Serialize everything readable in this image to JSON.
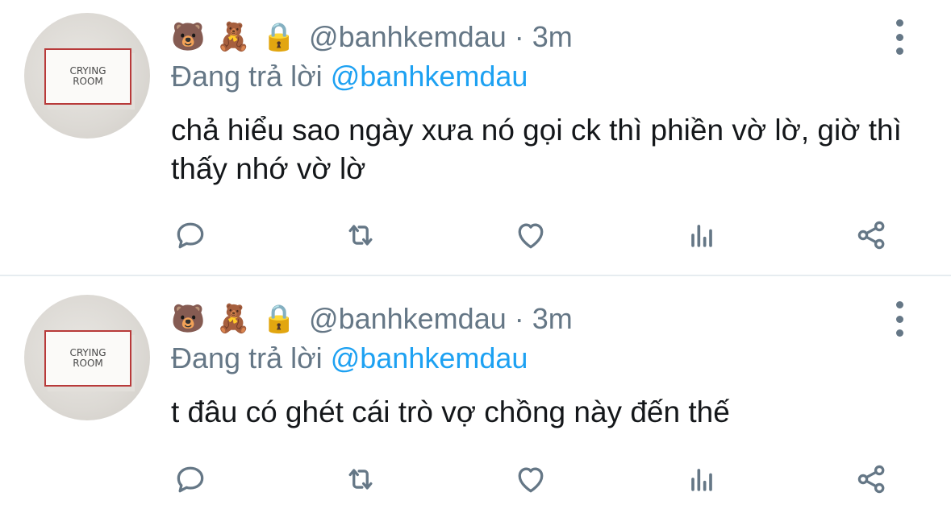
{
  "tweets": [
    {
      "avatar_text_line1": "CRYING",
      "avatar_text_line2": "ROOM",
      "name_emojis": [
        "🐻",
        "🧸",
        "🔒"
      ],
      "handle": "@banhkemdau",
      "separator": "·",
      "time": "3m",
      "reply_prefix": "Đang trả lời",
      "reply_to": "@banhkemdau",
      "text": "chả hiểu sao ngày xưa nó gọi ck thì phiền vờ lờ, giờ thì thấy nhớ vờ lờ"
    },
    {
      "avatar_text_line1": "CRYING",
      "avatar_text_line2": "ROOM",
      "name_emojis": [
        "🐻",
        "🧸",
        "🔒"
      ],
      "handle": "@banhkemdau",
      "separator": "·",
      "time": "3m",
      "reply_prefix": "Đang trả lời",
      "reply_to": "@banhkemdau",
      "text": "t đâu có ghét cái trò vợ chồng này đến thế"
    }
  ],
  "icons": {
    "reply": "reply-icon",
    "retweet": "retweet-icon",
    "like": "heart-icon",
    "stats": "analytics-icon",
    "share": "share-icon",
    "more": "more-vertical-icon"
  },
  "colors": {
    "muted": "#657786",
    "mention": "#1da1f2",
    "text": "#14171a",
    "sign_border": "#b83a3a"
  }
}
